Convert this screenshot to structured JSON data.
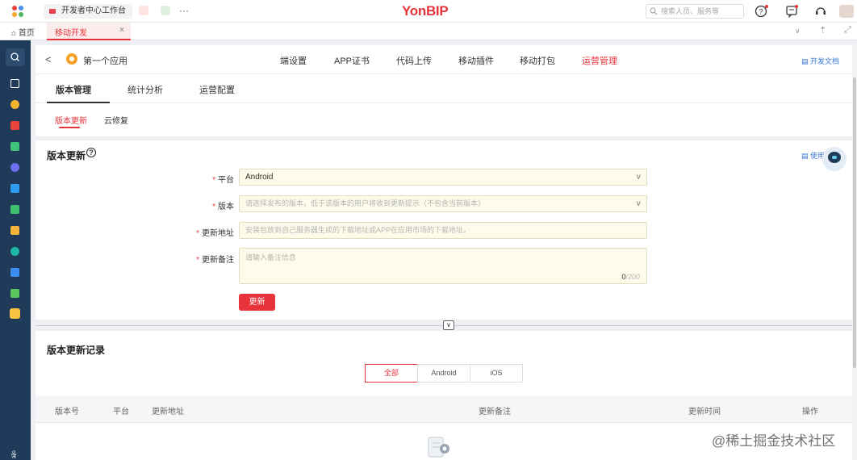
{
  "topbar": {
    "workbench_tab": "开发者中心工作台",
    "more": "···",
    "brand": "YonBIP",
    "search_placeholder": "搜索人员、服务等"
  },
  "navbar": {
    "home": "首页",
    "active_tab": "移动开发",
    "close": "×"
  },
  "app_header": {
    "back": "<",
    "app_name": "第一个应用",
    "nav": [
      "端设置",
      "APP证书",
      "代码上传",
      "移动插件",
      "移动打包",
      "运营管理"
    ],
    "active_nav_index": 5,
    "dev_docs": "开发文档"
  },
  "subtabs": [
    "版本管理",
    "统计分析",
    "运营配置"
  ],
  "third_tabs": [
    "版本更新",
    "云修复"
  ],
  "form": {
    "title": "版本更新",
    "help": "?",
    "usage": "使用",
    "required_mark": "*",
    "platform_label": "平台",
    "platform_value": "Android",
    "version_label": "版本",
    "version_placeholder": "请选择发布的版本，低于该版本的用户将收到更新提示（不包含当前版本）",
    "url_label": "更新地址",
    "url_placeholder": "安装包放到自己服务器生成的下载地址或APP在应用市场的下载地址。",
    "note_label": "更新备注",
    "note_placeholder": "请输入备注信息",
    "counter_current": "0",
    "counter_max": "/200",
    "submit": "更新"
  },
  "records": {
    "title": "版本更新记录",
    "filters": [
      "全部",
      "Android",
      "iOS"
    ],
    "columns": [
      "版本号",
      "平台",
      "更新地址",
      "更新备注",
      "更新时间",
      "操作"
    ]
  },
  "watermark": "@稀土掘金技术社区",
  "colors": {
    "accent": "#e8333b",
    "sidebar": "#1f3b59",
    "link": "#3775d6",
    "input_bg": "#fdfbe9"
  }
}
